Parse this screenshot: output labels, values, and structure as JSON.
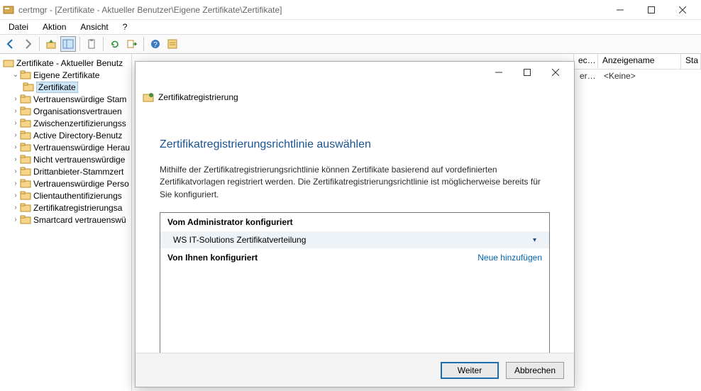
{
  "titlebar": {
    "title": "certmgr - [Zertifikate - Aktueller Benutzer\\Eigene Zertifikate\\Zertifikate]"
  },
  "menus": [
    "Datei",
    "Aktion",
    "Ansicht",
    "?"
  ],
  "tree": {
    "root": "Zertifikate - Aktueller Benutz",
    "eigene": "Eigene Zertifikate",
    "selected": "Zertifikate",
    "items": [
      "Vertrauenswürdige Stam",
      "Organisationsvertrauen",
      "Zwischenzertifizierungss",
      "Active Directory-Benutz",
      "Vertrauenswürdige Herau",
      "Nicht vertrauenswürdige",
      "Drittanbieter-Stammzert",
      "Vertrauenswürdige Perso",
      "Clientauthentifizierungs",
      "Zertifikatregistrierungsa",
      "Smartcard vertrauenswü"
    ]
  },
  "columns": {
    "h1": "ec…",
    "h2": "Anzeigename",
    "h3": "Sta",
    "row1a": "er…",
    "row1b": "<Keine>"
  },
  "dialog": {
    "brand": "Zertifikatregistrierung",
    "heading": "Zertifikatregistrierungsrichtlinie auswählen",
    "text": "Mithilfe der Zertifikatregistrierungsrichtlinie können Zertifikate basierend auf vordefinierten Zertifikatvorlagen registriert werden. Die Zertifikatregistrierungsrichtlinie ist möglicherweise bereits für Sie konfiguriert.",
    "admin_header": "Vom Administrator konfiguriert",
    "policy_item": "WS IT-Solutions Zertifikatverteilung",
    "user_header": "Von Ihnen konfiguriert",
    "add_link": "Neue hinzufügen",
    "btn_next": "Weiter",
    "btn_cancel": "Abbrechen"
  }
}
